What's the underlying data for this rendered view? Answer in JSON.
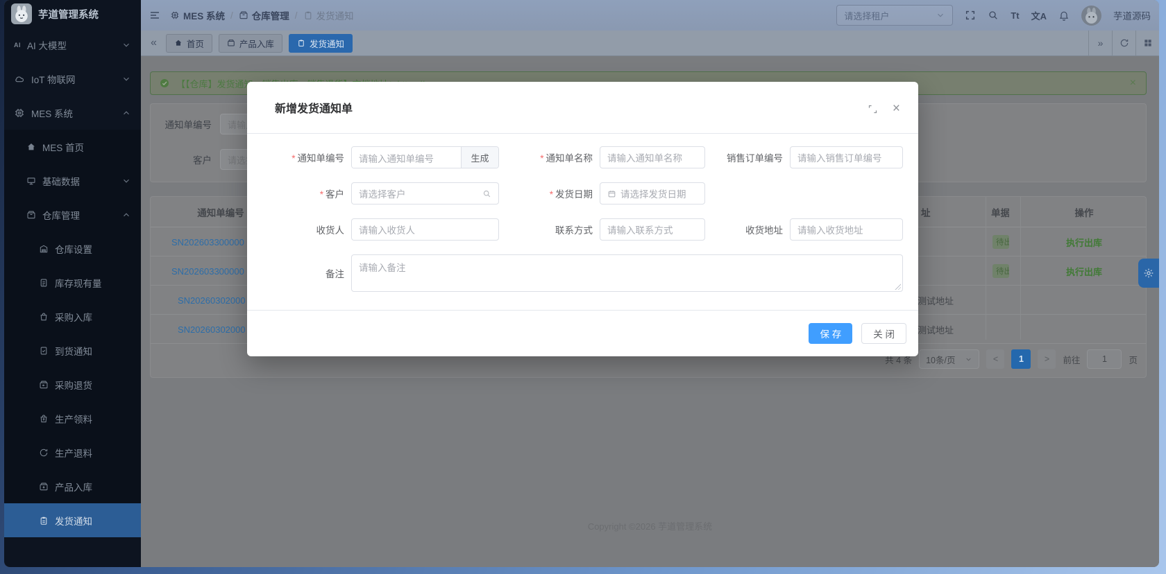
{
  "colors": {
    "accent": "#409eff",
    "success": "#67c23a",
    "danger": "#f56c6c",
    "sidebar_bg": "#001529"
  },
  "sidebar": {
    "logo_title": "芋道管理系统",
    "items": [
      {
        "label": "AI 大模型",
        "icon": "ai-icon",
        "chevron": "down"
      },
      {
        "label": "IoT 物联网",
        "icon": "cloud-icon",
        "chevron": "down"
      },
      {
        "label": "MES 系统",
        "icon": "chip-icon",
        "chevron": "up"
      },
      {
        "label": "MES 首页",
        "icon": "home-icon"
      },
      {
        "label": "基础数据",
        "icon": "monitor-icon",
        "chevron": "down"
      },
      {
        "label": "仓库管理",
        "icon": "package-icon",
        "chevron": "up"
      },
      {
        "label": "仓库设置",
        "icon": "warehouse-icon"
      },
      {
        "label": "库存现有量",
        "icon": "document-icon"
      },
      {
        "label": "采购入库",
        "icon": "bag-icon"
      },
      {
        "label": "到货通知",
        "icon": "doc-check-icon"
      },
      {
        "label": "采购退货",
        "icon": "package-return-icon"
      },
      {
        "label": "生产领料",
        "icon": "bag-out-icon"
      },
      {
        "label": "生产退料",
        "icon": "refresh-icon"
      },
      {
        "label": "产品入库",
        "icon": "package-in-icon"
      },
      {
        "label": "发货通知",
        "icon": "clipboard-icon",
        "active": true
      }
    ]
  },
  "navbar": {
    "breadcrumb": [
      {
        "label": "MES 系统",
        "icon": "chip-icon"
      },
      {
        "label": "仓库管理",
        "icon": "package-icon"
      },
      {
        "label": "发货通知",
        "icon": "clipboard-icon"
      }
    ],
    "separator": "/",
    "tenant_placeholder": "请选择租户",
    "username": "芋道源码",
    "icons": [
      "fullscreen-icon",
      "search-icon",
      "font-size-icon",
      "translate-icon",
      "bell-icon"
    ],
    "font_size_glyph": "Tt",
    "translate_glyph": "文A"
  },
  "tabbar": {
    "tabs": [
      {
        "label": "首页",
        "icon": "home-icon"
      },
      {
        "label": "产品入库",
        "icon": "package-icon"
      },
      {
        "label": "发货通知",
        "icon": "clipboard-icon",
        "active": true
      }
    ],
    "collapse_left": "«",
    "expand_right": "»"
  },
  "alert": {
    "text": "【【仓库】发货通知、销售出库、销售退货】文档地址：https://",
    "icon": "check-circle-icon",
    "close": "×"
  },
  "search": {
    "fields": [
      {
        "label": "通知单编号",
        "placeholder": "请输入通知单编号"
      },
      {
        "label": "客户",
        "placeholder": "请选择客户"
      }
    ]
  },
  "table": {
    "headers": {
      "sn": "通知单编号",
      "address_fragment": "址",
      "status_fragment": "单据",
      "actions": "操作"
    },
    "rows": [
      {
        "sn": "SN202603300000",
        "status": "待出库",
        "action": "执行出库"
      },
      {
        "sn": "SN202603300000",
        "status": "待出库",
        "action": "执行出库"
      },
      {
        "sn": "SN20260302000",
        "address": "测试地址"
      },
      {
        "sn": "SN20260302000",
        "address": "测试地址"
      }
    ]
  },
  "pagination": {
    "total": "共 4 条",
    "page_size": "10条/页",
    "prev": "<",
    "next": ">",
    "current_page": "1",
    "goto_label": "前往",
    "goto_value": "1",
    "page_unit": "页"
  },
  "footer": {
    "copyright": "Copyright ©2026 芋道管理系统"
  },
  "modal": {
    "title": "新增发货通知单",
    "required_mark": "*",
    "rows": {
      "notice_no": {
        "label": "通知单编号",
        "placeholder": "请输入通知单编号",
        "generate": "生成"
      },
      "notice_name": {
        "label": "通知单名称",
        "placeholder": "请输入通知单名称"
      },
      "sales_order_no": {
        "label": "销售订单编号",
        "placeholder": "请输入销售订单编号"
      },
      "customer": {
        "label": "客户",
        "placeholder": "请选择客户"
      },
      "ship_date": {
        "label": "发货日期",
        "placeholder": "请选择发货日期"
      },
      "receiver": {
        "label": "收货人",
        "placeholder": "请输入收货人"
      },
      "contact": {
        "label": "联系方式",
        "placeholder": "请输入联系方式"
      },
      "address": {
        "label": "收货地址",
        "placeholder": "请输入收货地址"
      },
      "remark": {
        "label": "备注",
        "placeholder": "请输入备注"
      }
    },
    "save_label": "保 存",
    "close_label": "关 闭"
  }
}
